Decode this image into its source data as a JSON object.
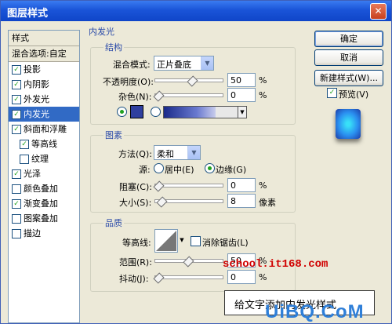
{
  "window": {
    "title": "图层样式",
    "close_glyph": "✕"
  },
  "style_list": {
    "header": "样式",
    "blend_options": "混合选项:自定",
    "items": [
      {
        "label": "投影",
        "checked": true
      },
      {
        "label": "内阴影",
        "checked": true
      },
      {
        "label": "外发光",
        "checked": true
      },
      {
        "label": "内发光",
        "checked": true,
        "selected": true
      },
      {
        "label": "斜面和浮雕",
        "checked": true
      },
      {
        "label": "等高线",
        "checked": true,
        "sub": true
      },
      {
        "label": "纹理",
        "checked": false,
        "sub": true
      },
      {
        "label": "光泽",
        "checked": true
      },
      {
        "label": "颜色叠加",
        "checked": false
      },
      {
        "label": "渐变叠加",
        "checked": true
      },
      {
        "label": "图案叠加",
        "checked": false
      },
      {
        "label": "描边",
        "checked": false
      }
    ]
  },
  "panel": {
    "title": "内发光",
    "structure": {
      "legend": "结构",
      "blend_mode_label": "混合模式:",
      "blend_mode_value": "正片叠底",
      "opacity_label": "不透明度(O):",
      "opacity_value": "50",
      "opacity_unit": "%",
      "noise_label": "杂色(N):",
      "noise_value": "0",
      "noise_unit": "%",
      "color_swatch": "#2f3f9f"
    },
    "elements": {
      "legend": "图素",
      "method_label": "方法(Q):",
      "method_value": "柔和",
      "source_label": "源:",
      "source_center": "居中(E)",
      "source_edge": "边缘(G)",
      "choke_label": "阻塞(C):",
      "choke_value": "0",
      "choke_unit": "%",
      "size_label": "大小(S):",
      "size_value": "8",
      "size_unit": "像素"
    },
    "quality": {
      "legend": "品质",
      "contour_label": "等高线:",
      "antialias_label": "消除锯齿(L)",
      "range_label": "范围(R):",
      "range_value": "50",
      "range_unit": "%",
      "jitter_label": "抖动(J):",
      "jitter_value": "0",
      "jitter_unit": "%"
    }
  },
  "buttons": {
    "ok": "确定",
    "cancel": "取消",
    "new_style": "新建样式(W)...",
    "preview": "预览(V)"
  },
  "watermarks": {
    "site": "school.it168.com",
    "caption": "给文字添加内发光样式",
    "logo": "UiBQ.CoM"
  },
  "colors": {
    "title_bar": "#1a54d8",
    "selection": "#316ac5",
    "accent_red": "#d00000"
  }
}
